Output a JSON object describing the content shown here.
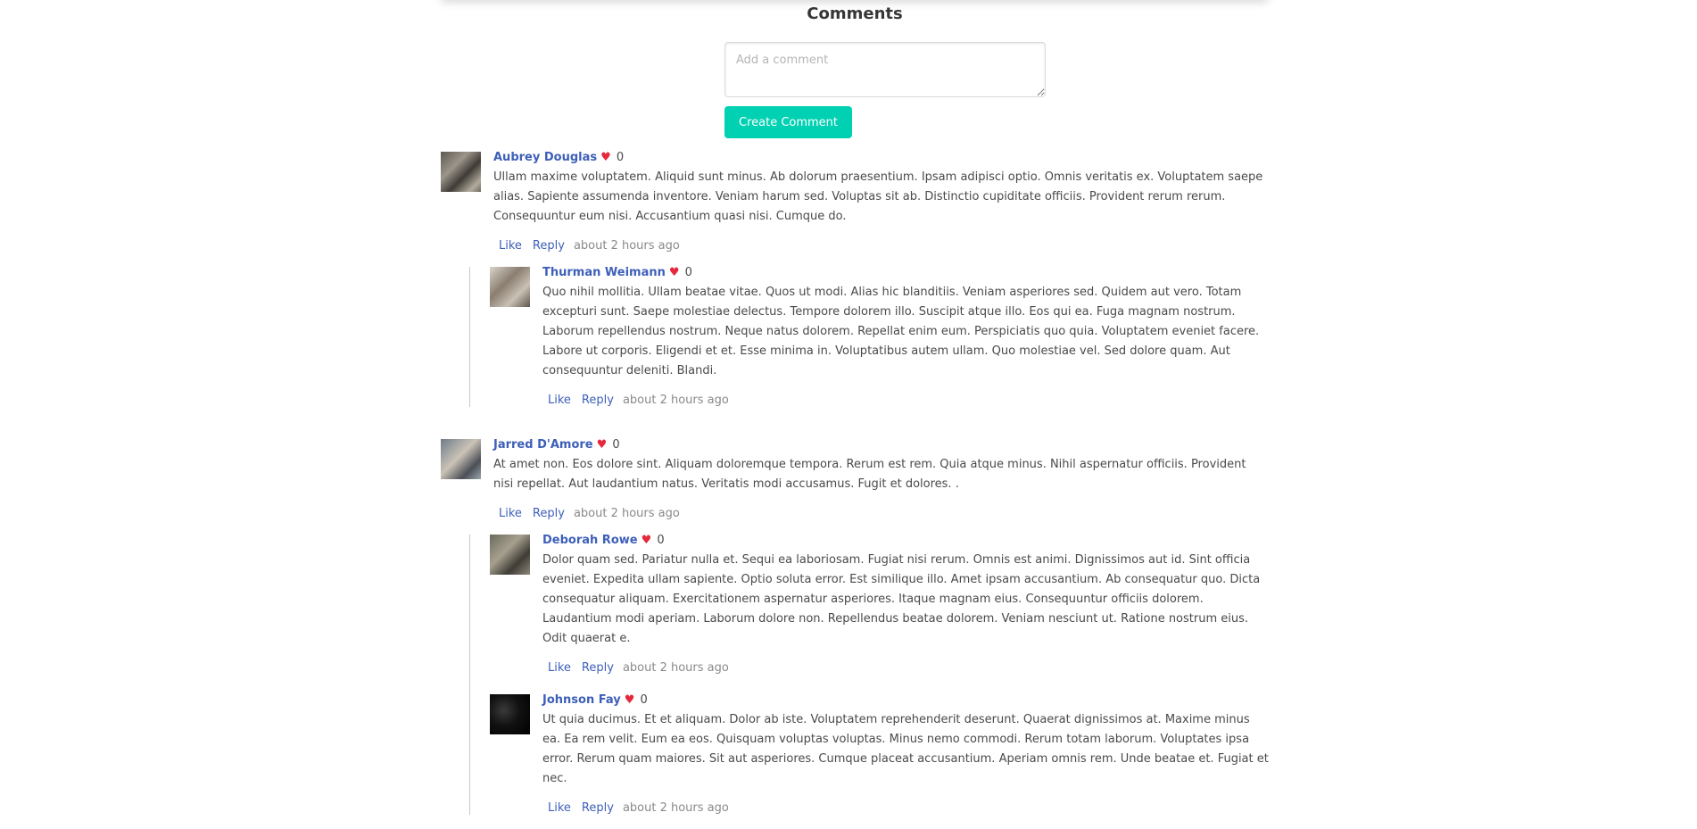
{
  "page": {
    "section_title": "Comments"
  },
  "new_comment": {
    "placeholder": "Add a comment",
    "submit_label": "Create Comment"
  },
  "actions": {
    "like": "Like",
    "reply": "Reply"
  },
  "threads": [
    {
      "author": "Aubrey Douglas",
      "heart": "♥",
      "likes": "0",
      "text": "Ullam maxime voluptatem. Aliquid sunt minus. Ab dolorum praesentium. Ipsam adipisci optio. Omnis veritatis ex. Voluptatem saepe alias. Sapiente assumenda inventore. Veniam harum sed. Voluptas sit ab. Distinctio cupiditate officiis. Provident rerum rerum. Consequuntur eum nisi. Accusantium quasi nisi. Cumque do.",
      "time": "about 2 hours ago",
      "replies": [
        {
          "author": "Thurman Weimann",
          "heart": "♥",
          "likes": "0",
          "text": "Quo nihil mollitia. Ullam beatae vitae. Quos ut modi. Alias hic blanditiis. Veniam asperiores sed. Quidem aut vero. Totam excepturi sunt. Saepe molestiae delectus. Tempore dolorem illo. Suscipit atque illo. Eos qui ea. Fuga magnam nostrum. Laborum repellendus nostrum. Neque natus dolorem. Repellat enim eum. Perspiciatis quo quia. Voluptatem eveniet facere. Labore ut corporis. Eligendi et et. Esse minima in. Voluptatibus autem ullam. Quo molestiae vel. Sed dolore quam. Aut consequuntur deleniti. Blandi.",
          "time": "about 2 hours ago"
        }
      ]
    },
    {
      "author": "Jarred D'Amore",
      "heart": "♥",
      "likes": "0",
      "text": "At amet non. Eos dolore sint. Aliquam doloremque tempora. Rerum est rem. Quia atque minus. Nihil aspernatur officiis. Provident nisi repellat. Aut laudantium natus. Veritatis modi accusamus. Fugit et dolores. .",
      "time": "about 2 hours ago",
      "replies": [
        {
          "author": "Deborah Rowe",
          "heart": "♥",
          "likes": "0",
          "text": "Dolor quam sed. Pariatur nulla et. Sequi ea laboriosam. Fugiat nisi rerum. Omnis est animi. Dignissimos aut id. Sint officia eveniet. Expedita ullam sapiente. Optio soluta error. Est similique illo. Amet ipsam accusantium. Ab consequatur quo. Dicta consequatur aliquam. Exercitationem aspernatur asperiores. Itaque magnam eius. Consequuntur officiis dolorem. Laudantium modi aperiam. Laborum dolore non. Repellendus beatae dolorem. Veniam nesciunt ut. Ratione nostrum eius. Odit quaerat e.",
          "time": "about 2 hours ago"
        },
        {
          "author": "Johnson Fay",
          "heart": "♥",
          "likes": "0",
          "text": "Ut quia ducimus. Et et aliquam. Dolor ab iste. Voluptatem reprehenderit deserunt. Quaerat dignissimos at. Maxime minus ea. Ea rem velit. Eum ea eos. Quisquam voluptas voluptas. Minus nemo commodi. Rerum totam laborum. Voluptates ipsa error. Rerum quam maiores. Sit aut asperiores. Cumque placeat accusantium. Aperiam omnis rem. Unde beatae et. Fugiat et nec.",
          "time": "about 2 hours ago"
        }
      ]
    }
  ]
}
